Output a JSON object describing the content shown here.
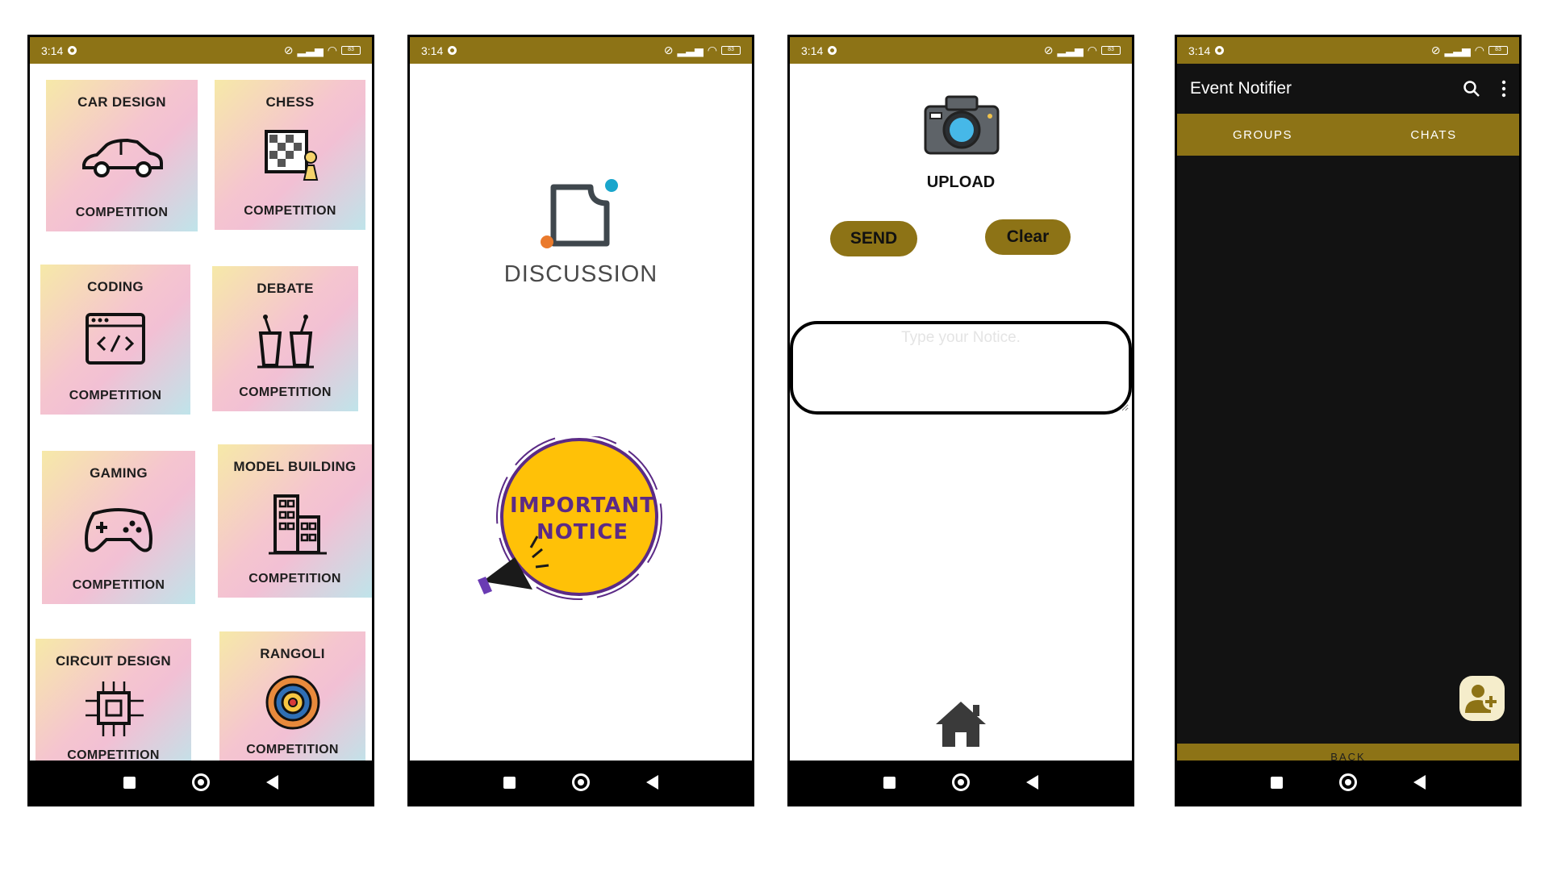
{
  "status_bar": {
    "time": "3:14",
    "battery": "83"
  },
  "phone1": {
    "cards": [
      {
        "title": "CAR DESIGN",
        "subtitle": "COMPETITION",
        "icon": "car-icon"
      },
      {
        "title": "CHESS",
        "subtitle": "COMPETITION",
        "icon": "chess-icon"
      },
      {
        "title": "CODING",
        "subtitle": "COMPETITION",
        "icon": "code-icon"
      },
      {
        "title": "DEBATE",
        "subtitle": "COMPETITION",
        "icon": "podium-icon"
      },
      {
        "title": "GAMING",
        "subtitle": "COMPETITION",
        "icon": "gamepad-icon"
      },
      {
        "title": "MODEL BUILDING",
        "subtitle": "COMPETITION",
        "icon": "building-icon"
      },
      {
        "title": "CIRCUIT DESIGN",
        "subtitle": "COMPETITION",
        "icon": "circuit-icon"
      },
      {
        "title": "RANGOLI",
        "subtitle": "COMPETITION",
        "icon": "rangoli-icon"
      }
    ]
  },
  "phone2": {
    "discussion_label": "DISCUSSION",
    "notice_line1": "IMPORTANT",
    "notice_line2": "NOTICE"
  },
  "phone3": {
    "upload_label": "UPLOAD",
    "send_label": "SEND",
    "clear_label": "Clear",
    "notice_placeholder": "Type your Notice."
  },
  "phone4": {
    "app_title": "Event Notifier",
    "tabs": [
      {
        "label": "GROUPS"
      },
      {
        "label": "CHATS"
      }
    ],
    "back_label": "BACK"
  },
  "colors": {
    "accent": "#8d7316",
    "dark": "#121212",
    "notice_yellow": "#ffc107",
    "notice_purple": "#5b2a86"
  }
}
